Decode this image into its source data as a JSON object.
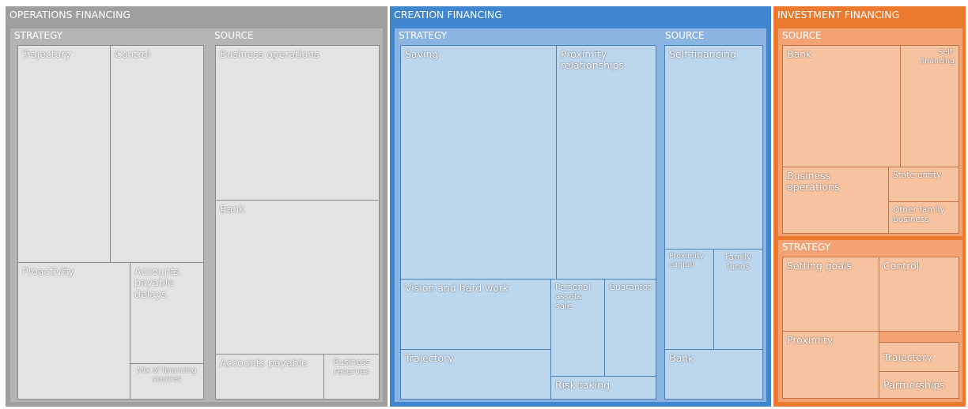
{
  "operations": {
    "title": "OPERATIONS FINANCING",
    "strategy": {
      "title": "STRATEGY",
      "cells": [
        "Trajectory",
        "Control",
        "Proactivity",
        "Accounts payable delays",
        "Mix of financing sources"
      ]
    },
    "source": {
      "title": "SOURCE",
      "cells": [
        "Business operations",
        "Bank",
        "Accounts payable",
        "Business reserves"
      ]
    }
  },
  "creation": {
    "title": "CREATION FINANCING",
    "strategy": {
      "title": "STRATEGY",
      "cells": [
        "Saving",
        "Proximity relationships",
        "Vision and hard work",
        "Personal assets sale",
        "Guarantor",
        "Trajectory",
        "Risk taking"
      ]
    },
    "source": {
      "title": "SOURCE",
      "cells": [
        "Self-financing",
        "Proximity capital",
        "Family funds",
        "Bank"
      ]
    }
  },
  "investment": {
    "title": "INVESTMENT FINANCING",
    "source": {
      "title": "SOURCE",
      "cells": [
        "Bank",
        "Self-financing",
        "Business operations",
        "State entity",
        "Other family business"
      ]
    },
    "strategy": {
      "title": "STRATEGY",
      "cells": [
        "Setting goals",
        "Control",
        "Proximity",
        "Trajectory",
        "Partnerships"
      ]
    }
  },
  "colors": {
    "operations": "#9e9e9e",
    "creation": "#3f86cf",
    "investment": "#ec7a2e"
  }
}
